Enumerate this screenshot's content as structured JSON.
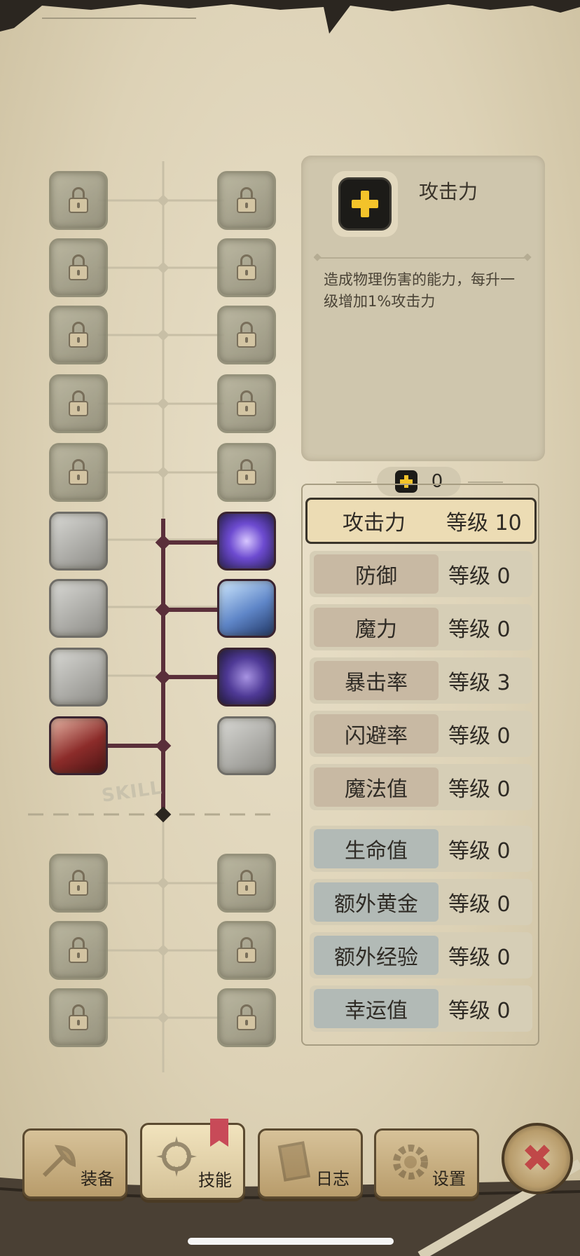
{
  "info": {
    "title": "攻击力",
    "description": "造成物理伤害的能力，每升一级增加1%攻击力",
    "icon": "plus-icon"
  },
  "points": {
    "icon": "plus-icon",
    "value": "0"
  },
  "skill_label": "SKILL",
  "stats": [
    {
      "name": "攻击力",
      "level": "等级 10",
      "selected": true
    },
    {
      "name": "防御",
      "level": "等级 0"
    },
    {
      "name": "魔力",
      "level": "等级 0"
    },
    {
      "name": "暴击率",
      "level": "等级 3"
    },
    {
      "name": "闪避率",
      "level": "等级 0"
    },
    {
      "name": "魔法值",
      "level": "等级 0"
    },
    {
      "name": "生命值",
      "level": "等级 0"
    },
    {
      "name": "额外黄金",
      "level": "等级 0"
    },
    {
      "name": "额外经验",
      "level": "等级 0"
    },
    {
      "name": "幸运值",
      "level": "等级 0"
    }
  ],
  "nav": {
    "equipment": "装备",
    "skills": "技能",
    "log": "日志",
    "settings": "设置"
  },
  "colors": {
    "accent": "#f3c32a",
    "tree_line": "#5a2f3a",
    "close": "#c04848"
  }
}
